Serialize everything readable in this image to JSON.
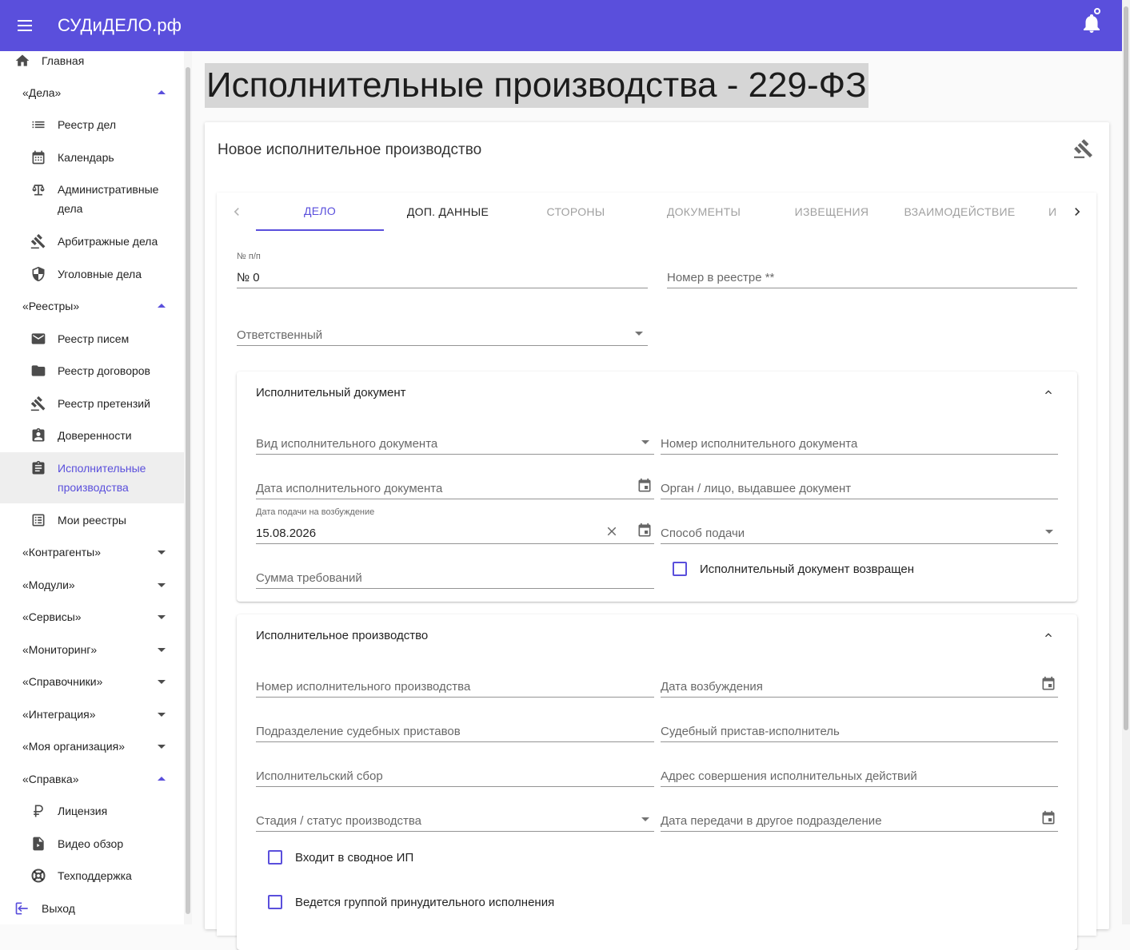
{
  "app": {
    "title": "СУДиДЕЛО.рф"
  },
  "sidebar": {
    "items": [
      {
        "label": "Главная",
        "icon": "home-icon",
        "kind": "top"
      },
      {
        "label": "«Дела»",
        "kind": "group",
        "expanded": true
      },
      {
        "label": "Реестр дел",
        "icon": "list-icon"
      },
      {
        "label": "Календарь",
        "icon": "calendar-icon"
      },
      {
        "label": "Административные",
        "label2": "дела",
        "icon": "scales-icon"
      },
      {
        "label": "Арбитражные дела",
        "icon": "gavel-icon"
      },
      {
        "label": "Уголовные дела",
        "icon": "shield-icon"
      },
      {
        "label": "«Реестры»",
        "kind": "group",
        "expanded": true
      },
      {
        "label": "Реестр писем",
        "icon": "mail-icon"
      },
      {
        "label": "Реестр договоров",
        "icon": "folder-icon"
      },
      {
        "label": "Реестр претензий",
        "icon": "gavel-icon"
      },
      {
        "label": "Доверенности",
        "icon": "badge-icon"
      },
      {
        "label": "Исполнительные",
        "label2": "производства",
        "icon": "clipboard-icon",
        "active": true
      },
      {
        "label": "Мои реестры",
        "icon": "checklist-icon"
      },
      {
        "label": "«Контрагенты»",
        "kind": "group",
        "expanded": false
      },
      {
        "label": "«Модули»",
        "kind": "group",
        "expanded": false
      },
      {
        "label": "«Сервисы»",
        "kind": "group",
        "expanded": false
      },
      {
        "label": "«Мониторинг»",
        "kind": "group",
        "expanded": false
      },
      {
        "label": "«Справочники»",
        "kind": "group",
        "expanded": false
      },
      {
        "label": "«Интеграция»",
        "kind": "group",
        "expanded": false
      },
      {
        "label": "«Моя организация»",
        "kind": "group",
        "expanded": false
      },
      {
        "label": "«Справка»",
        "kind": "group",
        "expanded": true
      },
      {
        "label": "Лицензия",
        "icon": "ruble-icon"
      },
      {
        "label": "Видео обзор",
        "icon": "video-file-icon"
      },
      {
        "label": "Техподдержка",
        "icon": "lifebuoy-icon"
      },
      {
        "label": "Выход",
        "icon": "logout-icon",
        "kind": "top"
      }
    ]
  },
  "page": {
    "title": "Исполнительные производства - 229-ФЗ"
  },
  "card": {
    "title": "Новое исполнительное производство"
  },
  "tabs": [
    "ДЕЛО",
    "ДОП. ДАННЫЕ",
    "СТОРОНЫ",
    "ДОКУМЕНТЫ",
    "ИЗВЕЩЕНИЯ",
    "ВЗАИМОДЕЙСТВИЕ",
    "И"
  ],
  "fields": {
    "num_label": "№ п/п",
    "num_value": "№ 0",
    "registry_number": "Номер в реестре **",
    "responsible": "Ответственный"
  },
  "panel1": {
    "title": "Исполнительный документ",
    "doc_type": "Вид исполнительного документа",
    "doc_number": "Номер исполнительного документа",
    "doc_date": "Дата исполнительного документа",
    "issuer": "Орган / лицо, выдавшее документ",
    "submit_date_label": "Дата подачи на возбуждение",
    "submit_date_value": "15.08.2026",
    "submit_method": "Способ подачи",
    "claim_sum": "Сумма требований",
    "returned": "Исполнительный документ возвращен"
  },
  "panel2": {
    "title": "Исполнительное производство",
    "proc_number": "Номер исполнительного производства",
    "init_date": "Дата возбуждения",
    "bailiff_dept": "Подразделение судебных приставов",
    "bailiff": "Судебный пристав-исполнитель",
    "fee": "Исполнительский сбор",
    "address": "Адрес совершения исполнительных действий",
    "stage": "Стадия / статус производства",
    "transfer_date": "Дата передачи в другое подразделение",
    "consolidated": "Входит в сводное ИП",
    "group_enforcement": "Ведется группой принудительного исполнения"
  },
  "colors": {
    "accent": "#5a4fdc",
    "topbar": "#5a4fdc"
  }
}
